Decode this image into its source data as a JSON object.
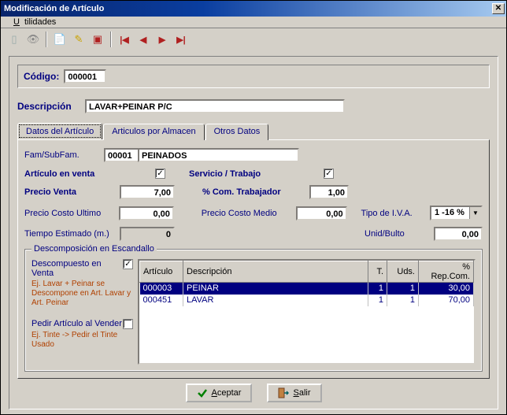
{
  "window": {
    "title": "Modificación de Artículo"
  },
  "menu": {
    "utilidades": "Utilidades"
  },
  "codigo": {
    "label": "Código:",
    "value": "000001"
  },
  "descripcion": {
    "label": "Descripción",
    "value": "LAVAR+PEINAR P/C"
  },
  "tabs": {
    "t0": "Datos del Artículo",
    "t1": "Articulos por Almacen",
    "t2": "Otros Datos"
  },
  "fields": {
    "fam_label": "Fam/SubFam.",
    "fam_code": "00001",
    "fam_name": "PEINADOS",
    "art_venta_label": "Artículo en venta",
    "serv_trab_label": "Servicio / Trabajo",
    "precio_venta_label": "Precio Venta",
    "precio_venta": "7,00",
    "pct_com_label": "% Com. Trabajador",
    "pct_com": "1,00",
    "precio_ult_label": "Precio Costo Ultimo",
    "precio_ult": "0,00",
    "precio_med_label": "Precio Costo Medio",
    "precio_med": "0,00",
    "tipo_iva_label": "Tipo de I.V.A.",
    "tipo_iva": "1 -16 %",
    "tiempo_label": "Tiempo Estimado (m.)",
    "tiempo": "0",
    "unid_bulto_label": "Unid/Bulto",
    "unid_bulto": "0,00"
  },
  "escandallo": {
    "legend": "Descomposición en Escandallo",
    "descomp_label": "Descompuesto en Venta",
    "descomp_hint": "Ej. Lavar + Peinar se Descompone en Art. Lavar y Art. Peinar",
    "pedir_label": "Pedir Artículo al Vender",
    "pedir_hint": "Ej. Tinte -> Pedir el Tinte Usado",
    "cols": {
      "c0": "Artículo",
      "c1": "Descripción",
      "c2": "T.",
      "c3": "Uds.",
      "c4": "% Rep.Com."
    },
    "rows": [
      {
        "art": "000003",
        "desc": "PEINAR",
        "t": "1",
        "uds": "1",
        "rep": "30,00"
      },
      {
        "art": "000451",
        "desc": "LAVAR",
        "t": "1",
        "uds": "1",
        "rep": "70,00"
      }
    ]
  },
  "buttons": {
    "aceptar": "Aceptar",
    "salir": "Salir"
  }
}
